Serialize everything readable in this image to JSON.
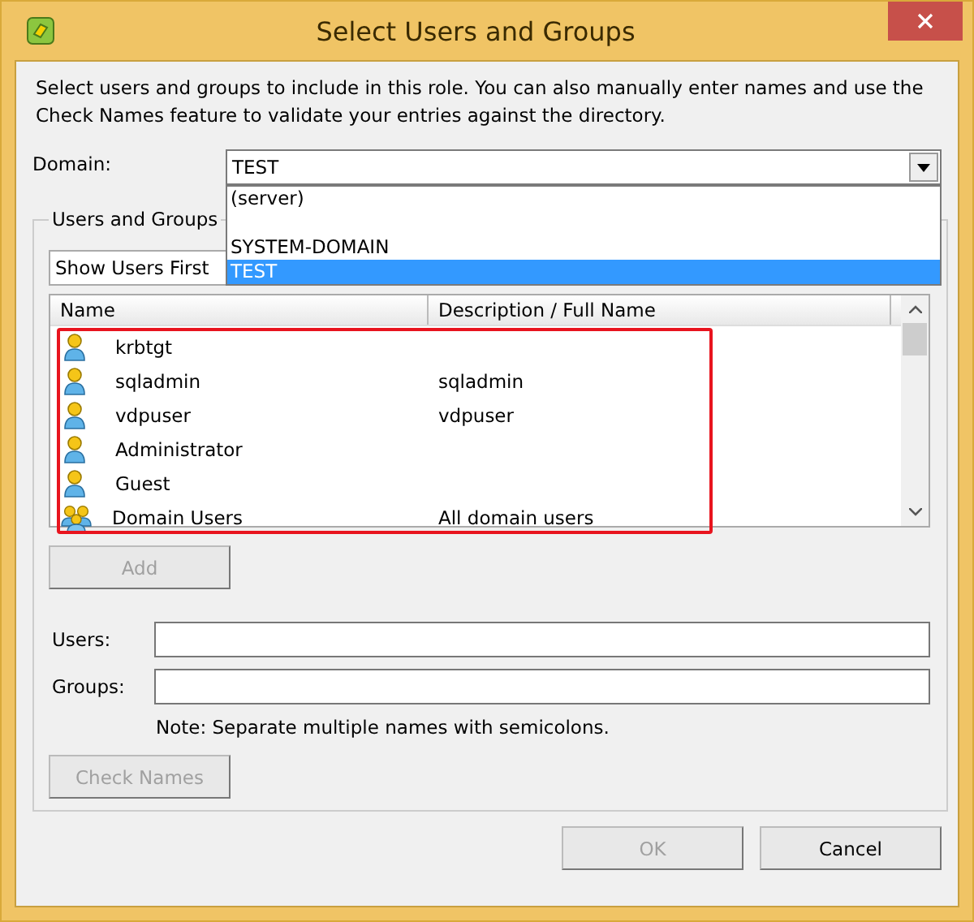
{
  "window": {
    "title": "Select Users and Groups"
  },
  "intro": "Select users and groups to include in this role. You can also manually enter names and use the Check Names feature to validate your entries against the directory.",
  "domain": {
    "label": "Domain:",
    "value": "TEST",
    "expanded": true,
    "options": [
      {
        "label": "(server)",
        "selected": false
      },
      {
        "label": "SYSTEM-DOMAIN",
        "selected": false
      },
      {
        "label": "TEST",
        "selected": true
      }
    ]
  },
  "group_box": {
    "title": "Users and Groups",
    "sort": {
      "value": "Show Users First"
    },
    "table": {
      "columns": [
        "Name",
        "Description / Full Name"
      ],
      "rows": [
        {
          "kind": "user",
          "name": "krbtgt",
          "description": ""
        },
        {
          "kind": "user",
          "name": "sqladmin",
          "description": "sqladmin"
        },
        {
          "kind": "user",
          "name": "vdpuser",
          "description": "vdpuser"
        },
        {
          "kind": "user",
          "name": "Administrator",
          "description": ""
        },
        {
          "kind": "user",
          "name": "Guest",
          "description": ""
        },
        {
          "kind": "group",
          "name": "Domain Users",
          "description": "All domain users"
        }
      ]
    },
    "add_button": {
      "label": "Add",
      "disabled": true
    },
    "users": {
      "label": "Users:"
    },
    "groups": {
      "label": "Groups:"
    },
    "note": "Note: Separate multiple names with semicolons.",
    "check_button": {
      "label": "Check Names",
      "disabled": true
    }
  },
  "buttons": [
    {
      "label": "OK",
      "disabled": true
    },
    {
      "label": "Cancel",
      "disabled": false
    }
  ]
}
